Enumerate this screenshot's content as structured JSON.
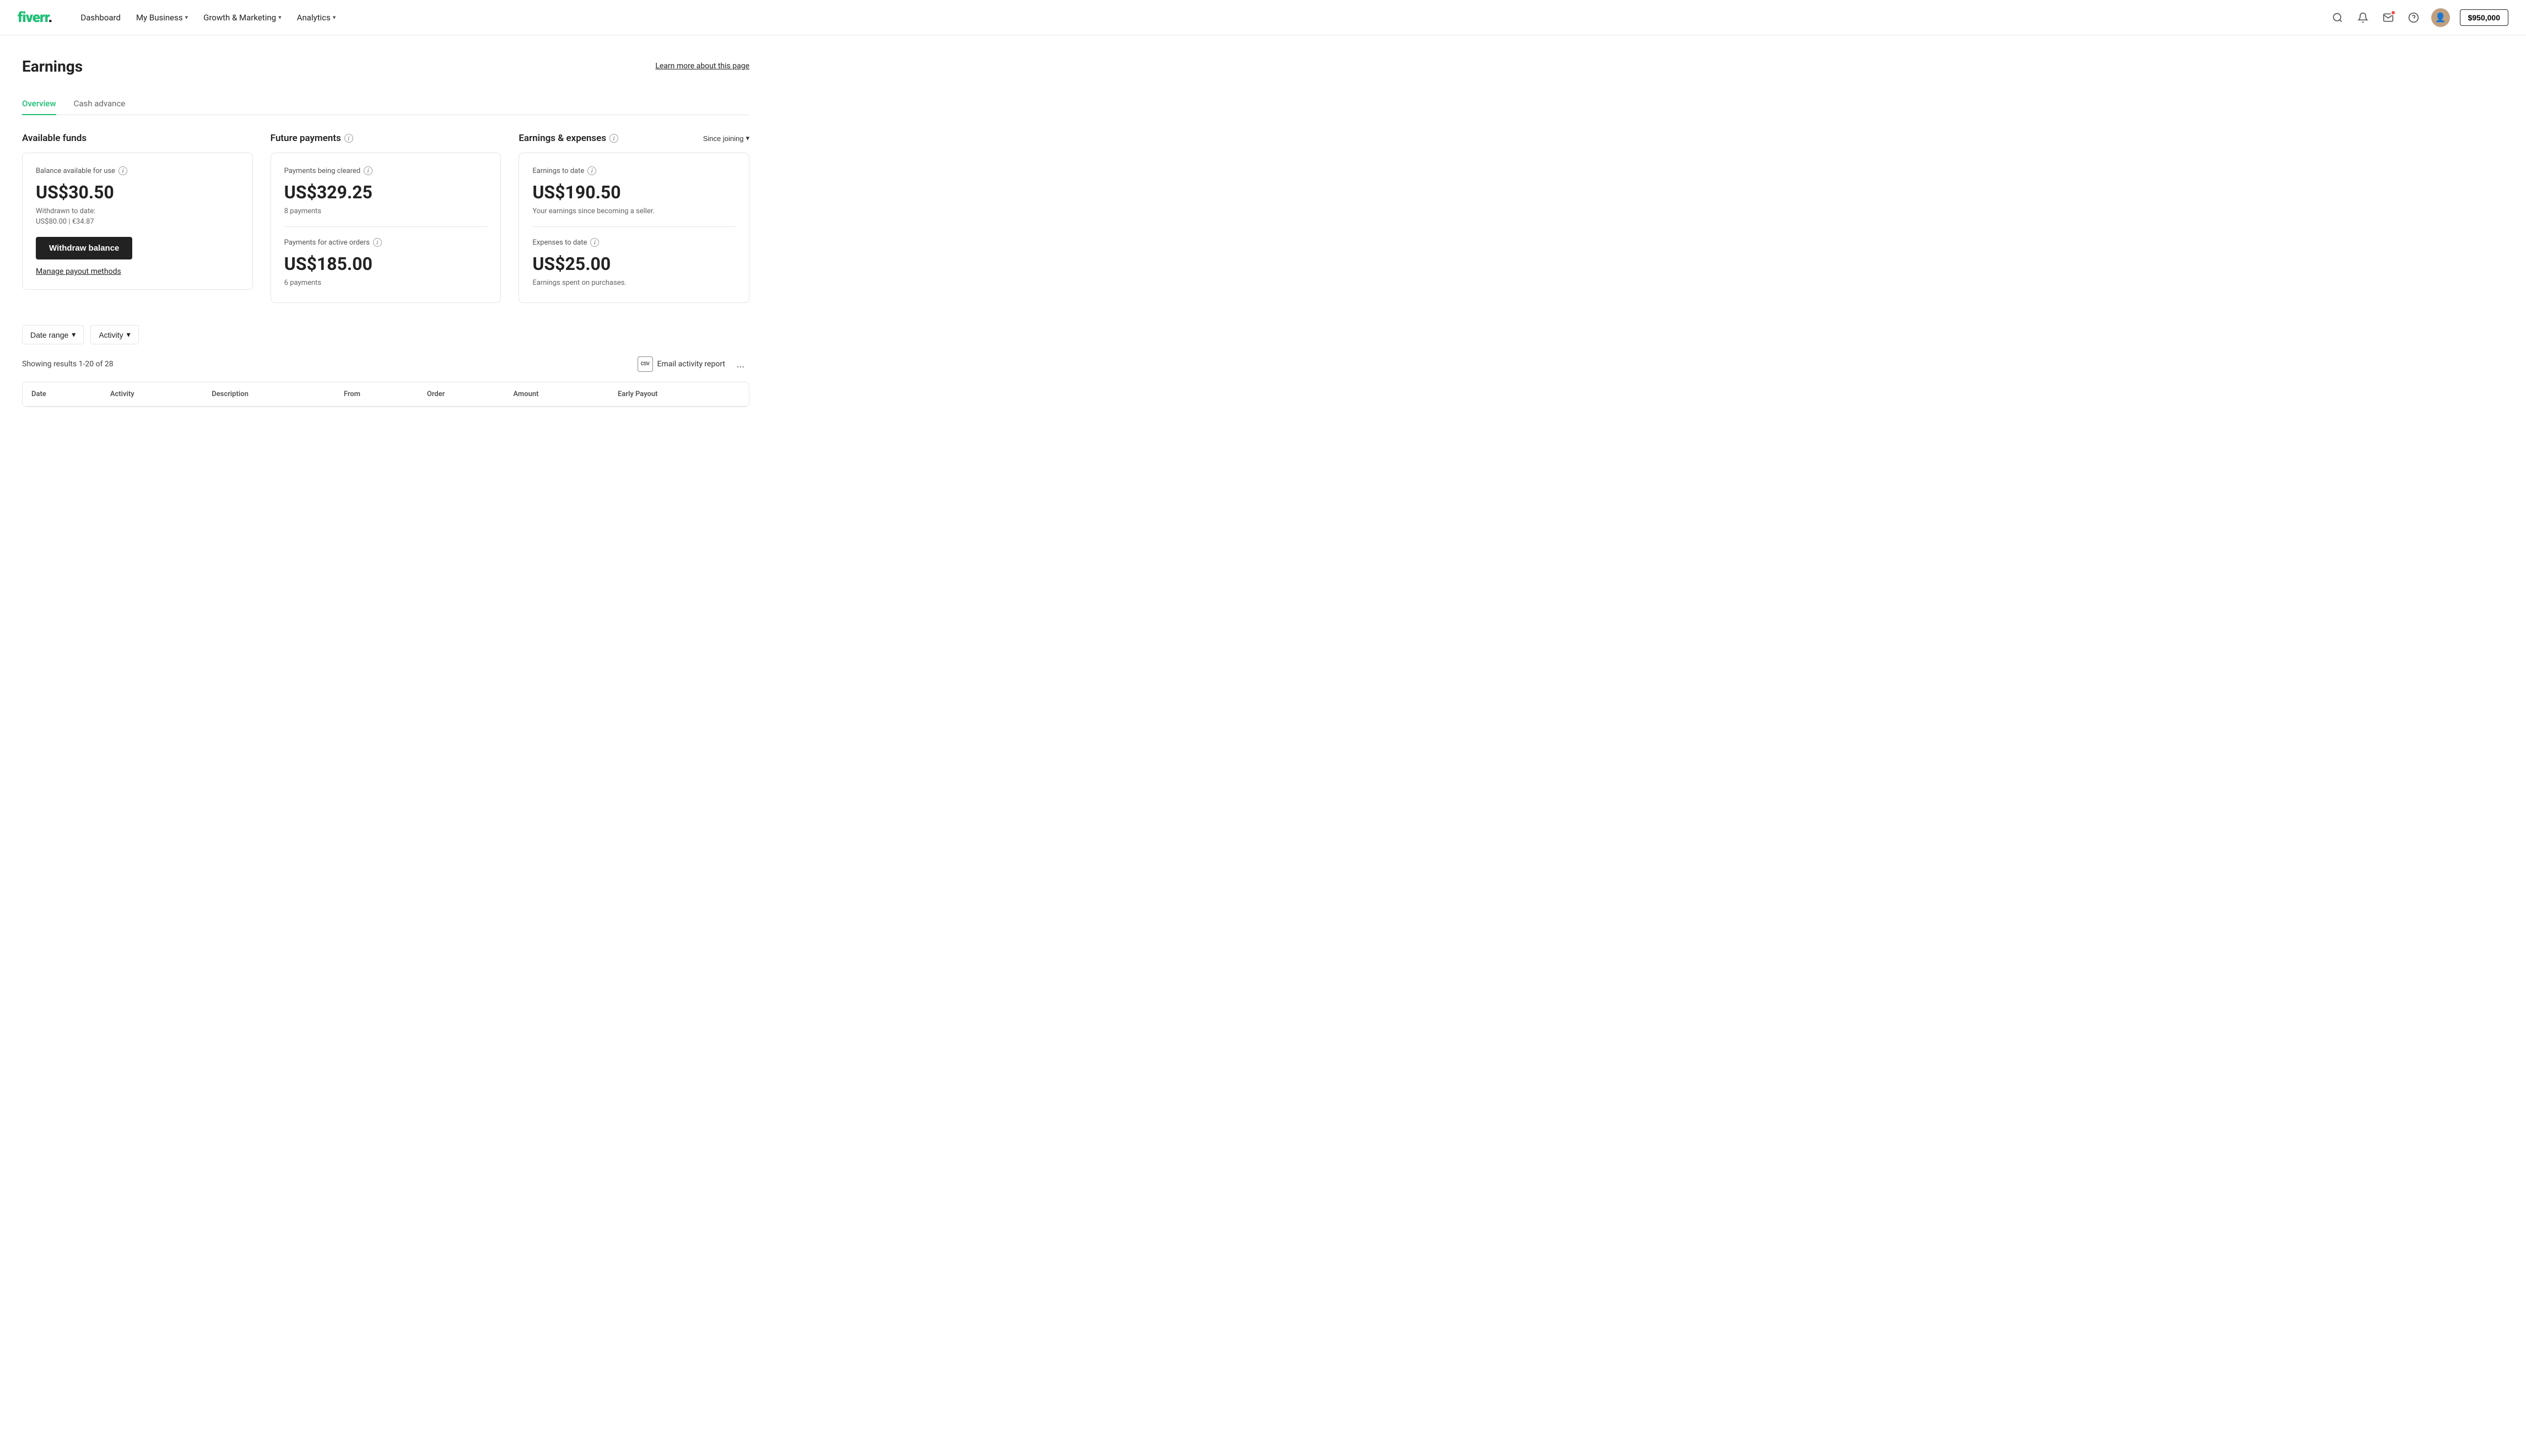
{
  "header": {
    "logo_text": "fiverr",
    "logo_dot": ".",
    "nav_items": [
      {
        "label": "Dashboard",
        "has_dropdown": false
      },
      {
        "label": "My Business",
        "has_dropdown": true
      },
      {
        "label": "Growth & Marketing",
        "has_dropdown": true
      },
      {
        "label": "Analytics",
        "has_dropdown": true
      }
    ],
    "balance": "$950,000"
  },
  "page": {
    "title": "Earnings",
    "learn_more": "Learn more about this page"
  },
  "tabs": [
    {
      "label": "Overview",
      "active": true
    },
    {
      "label": "Cash advance",
      "active": false
    }
  ],
  "available_funds": {
    "section_title": "Available funds",
    "card": {
      "label": "Balance available for use",
      "amount": "US$30.50",
      "withdrawn_label": "Withdrawn to date:",
      "withdrawn_value": "US$80.00  |  €34.87",
      "withdraw_btn": "Withdraw balance",
      "manage_link": "Manage payout methods"
    }
  },
  "future_payments": {
    "section_title": "Future payments",
    "clearing": {
      "label": "Payments being cleared",
      "amount": "US$329.25",
      "sub": "8 payments"
    },
    "active": {
      "label": "Payments for active orders",
      "amount": "US$185.00",
      "sub": "6 payments"
    }
  },
  "earnings_expenses": {
    "section_title": "Earnings & expenses",
    "filter_label": "Since joining",
    "earnings": {
      "label": "Earnings to date",
      "amount": "US$190.50",
      "sub": "Your earnings since becoming a seller."
    },
    "expenses": {
      "label": "Expenses to date",
      "amount": "US$25.00",
      "sub": "Earnings spent on purchases."
    }
  },
  "filters": {
    "date_range": "Date range",
    "activity": "Activity"
  },
  "results": {
    "text": "Showing results 1-20 of 28",
    "email_btn": "Email activity report",
    "more_btn": "..."
  },
  "table": {
    "columns": [
      "Date",
      "Activity",
      "Description",
      "From",
      "Order",
      "Amount",
      "Early Payout"
    ]
  }
}
